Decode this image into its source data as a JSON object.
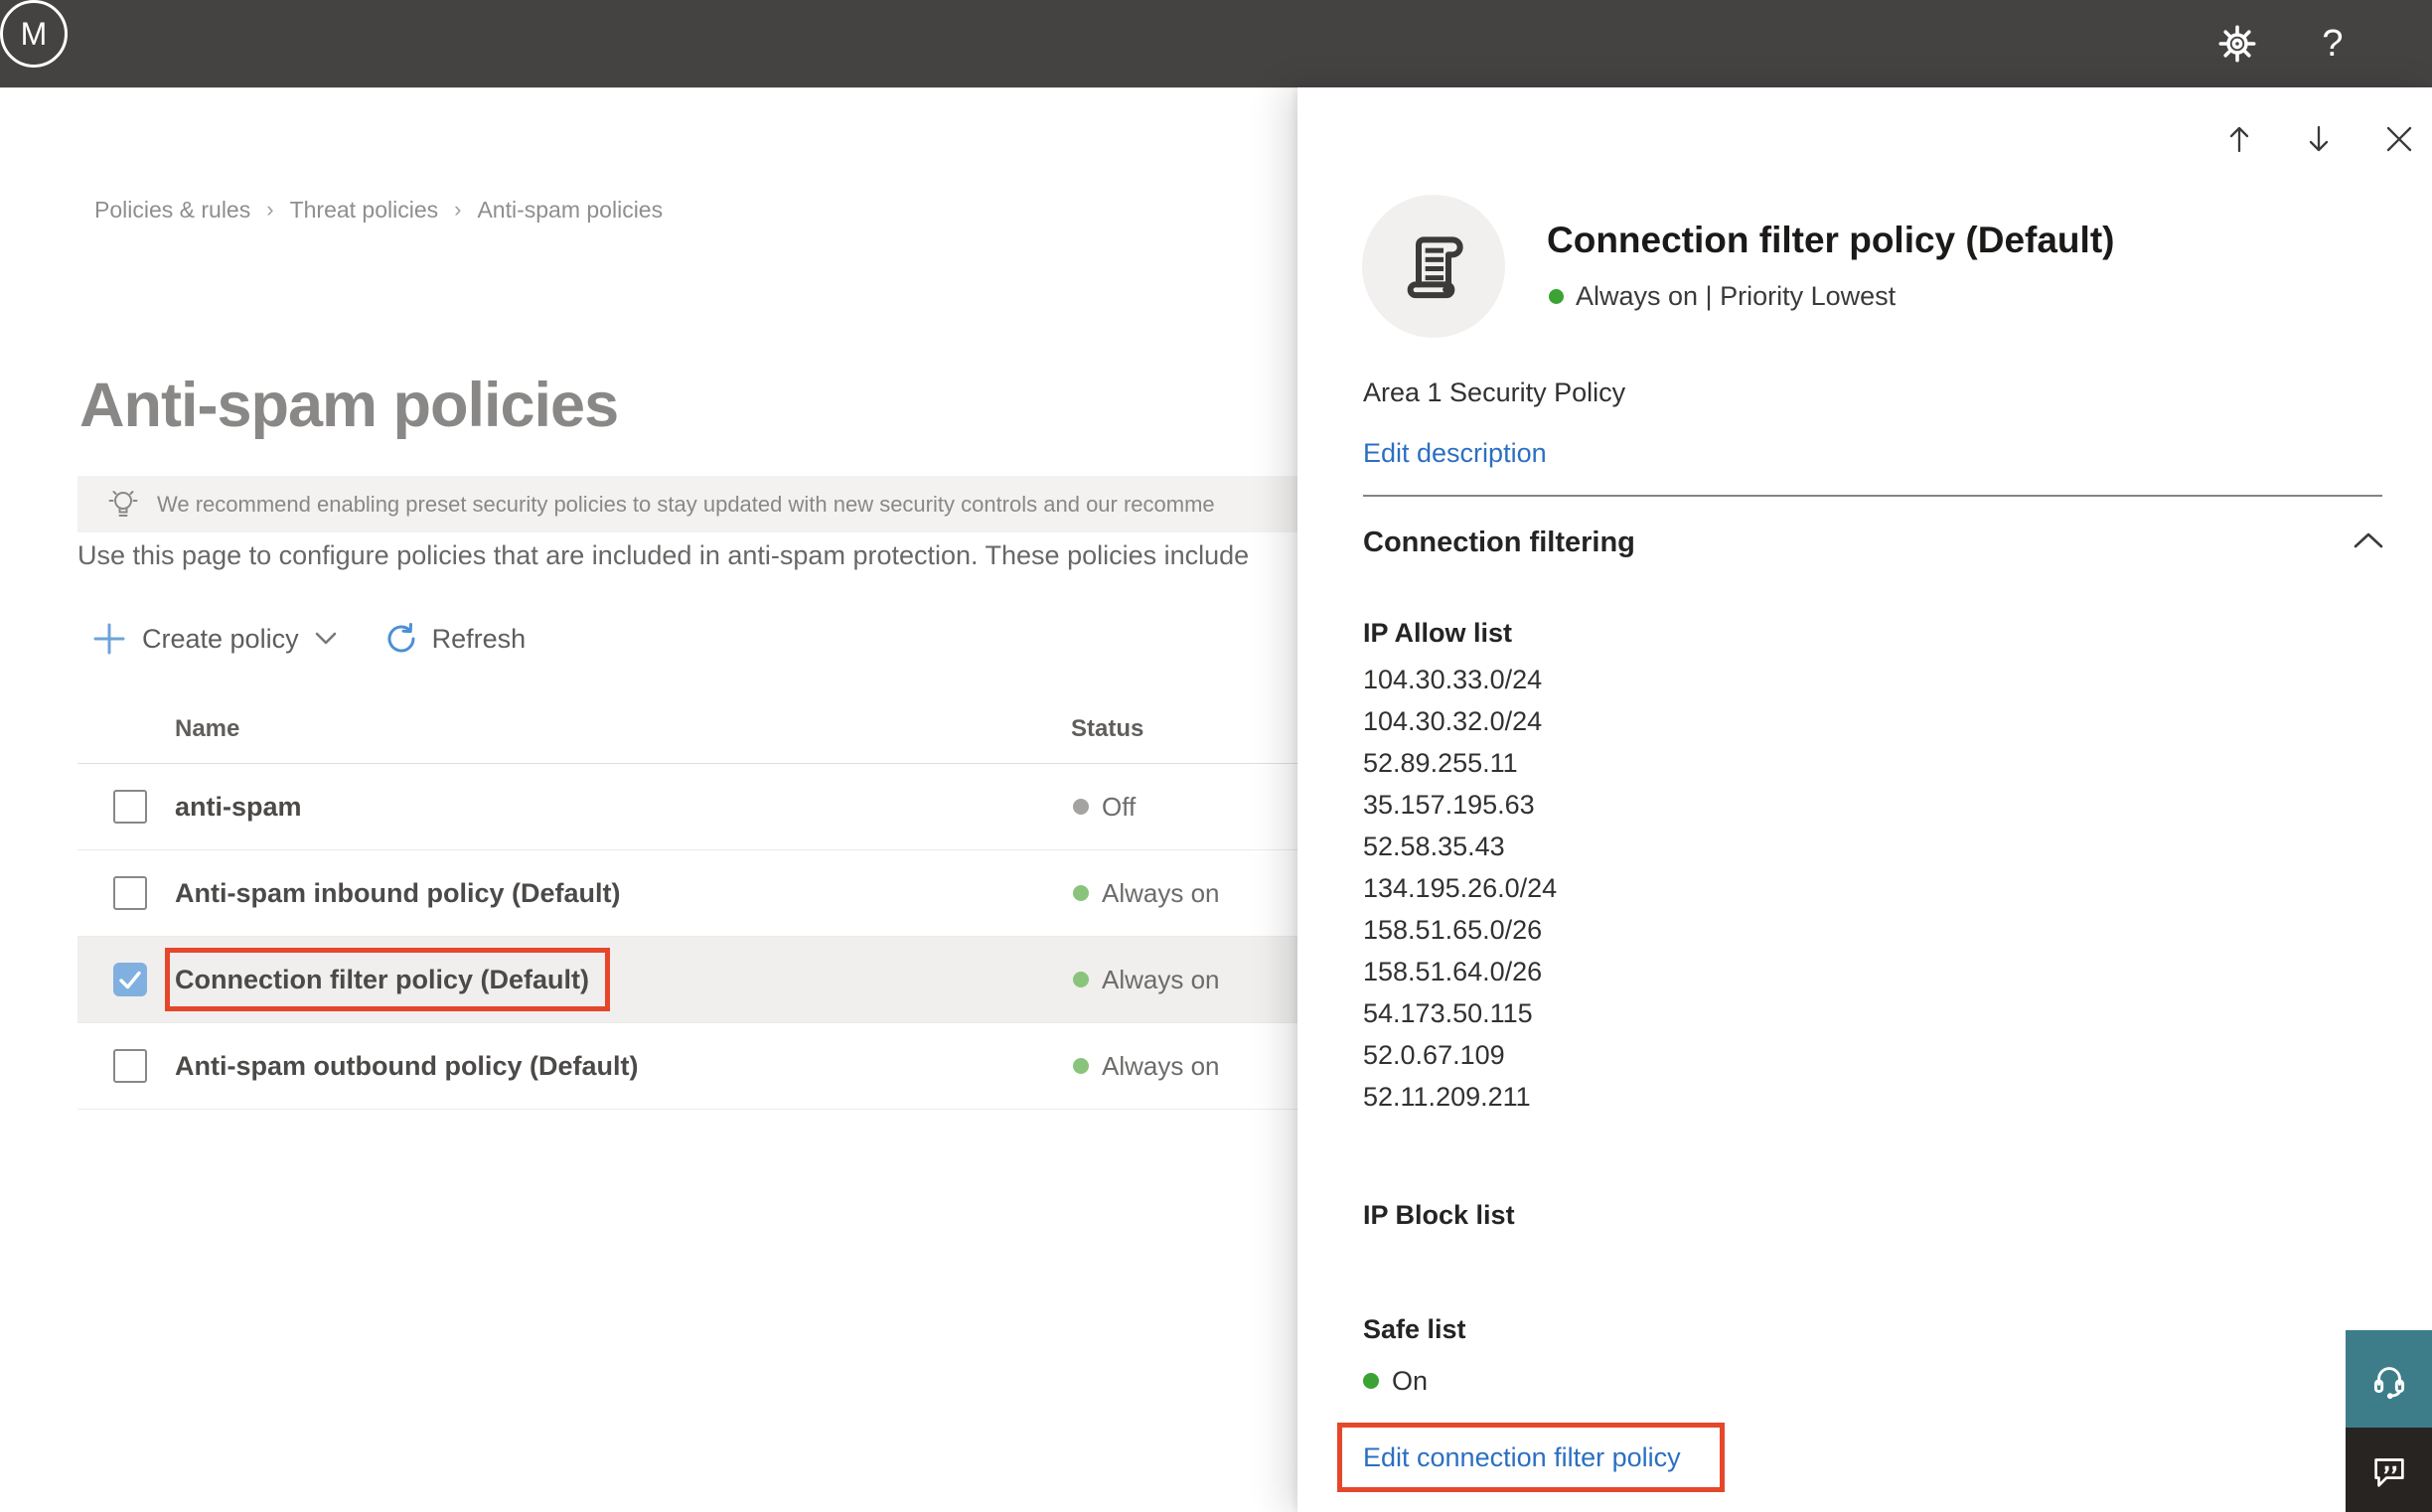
{
  "topbar": {
    "help_label": "?",
    "avatar_initial": "M"
  },
  "breadcrumb": {
    "separator": "›",
    "items": [
      "Policies & rules",
      "Threat policies",
      "Anti-spam policies"
    ]
  },
  "page": {
    "title": "Anti-spam policies",
    "banner": "We recommend enabling preset security policies to stay updated with new security controls and our recomme",
    "description": "Use this page to configure policies that are included in anti-spam protection. These policies include"
  },
  "toolbar": {
    "create_label": "Create policy",
    "refresh_label": "Refresh"
  },
  "table": {
    "columns": {
      "name": "Name",
      "status": "Status"
    },
    "rows": [
      {
        "name": "anti-spam",
        "status": "Off",
        "status_key": "off",
        "checked": false,
        "selected": false,
        "annotated": false
      },
      {
        "name": "Anti-spam inbound policy (Default)",
        "status": "Always on",
        "status_key": "on",
        "checked": false,
        "selected": false,
        "annotated": false
      },
      {
        "name": "Connection filter policy (Default)",
        "status": "Always on",
        "status_key": "on",
        "checked": true,
        "selected": true,
        "annotated": true
      },
      {
        "name": "Anti-spam outbound policy (Default)",
        "status": "Always on",
        "status_key": "on",
        "checked": false,
        "selected": false,
        "annotated": false
      }
    ]
  },
  "flyout": {
    "title": "Connection filter policy (Default)",
    "status_line": "Always on | Priority Lowest",
    "description": "Area 1 Security Policy",
    "edit_description_label": "Edit description",
    "section_title": "Connection filtering",
    "ip_allow": {
      "label": "IP Allow list",
      "items": [
        "104.30.33.0/24",
        "104.30.32.0/24",
        "52.89.255.11",
        "35.157.195.63",
        "52.58.35.43",
        "134.195.26.0/24",
        "158.51.65.0/26",
        "158.51.64.0/26",
        "54.173.50.115",
        "52.0.67.109",
        "52.11.209.211"
      ]
    },
    "ip_block_label": "IP Block list",
    "safe_list": {
      "label": "Safe list",
      "value": "On"
    },
    "edit_link_label": "Edit connection filter policy"
  },
  "icons": {
    "settings-icon": "⚙",
    "help-icon": "?",
    "lightbulb-icon": "💡",
    "add-icon": "+",
    "chevron-down-icon": "⌄",
    "refresh-icon": "⟳",
    "checkmark-icon": "✓",
    "move-up-icon": "↑",
    "move-down-icon": "↓",
    "close-icon": "✕",
    "scroll-icon": "scroll",
    "chevron-up-icon": "⌃",
    "headset-icon": "headset",
    "feedback-icon": "speech-bubble"
  },
  "colors": {
    "topbar_bg": "#454342",
    "annotation_red": "#e5472b",
    "status_on": "#8ac47c",
    "status_off": "#a5a3a1",
    "panel_status_on": "#3aa333",
    "checkbox_checked": "#7fb0e0",
    "link_blue": "#2b6fc2",
    "support_teal": "#3d7d89",
    "feedback_dark": "#272421"
  }
}
